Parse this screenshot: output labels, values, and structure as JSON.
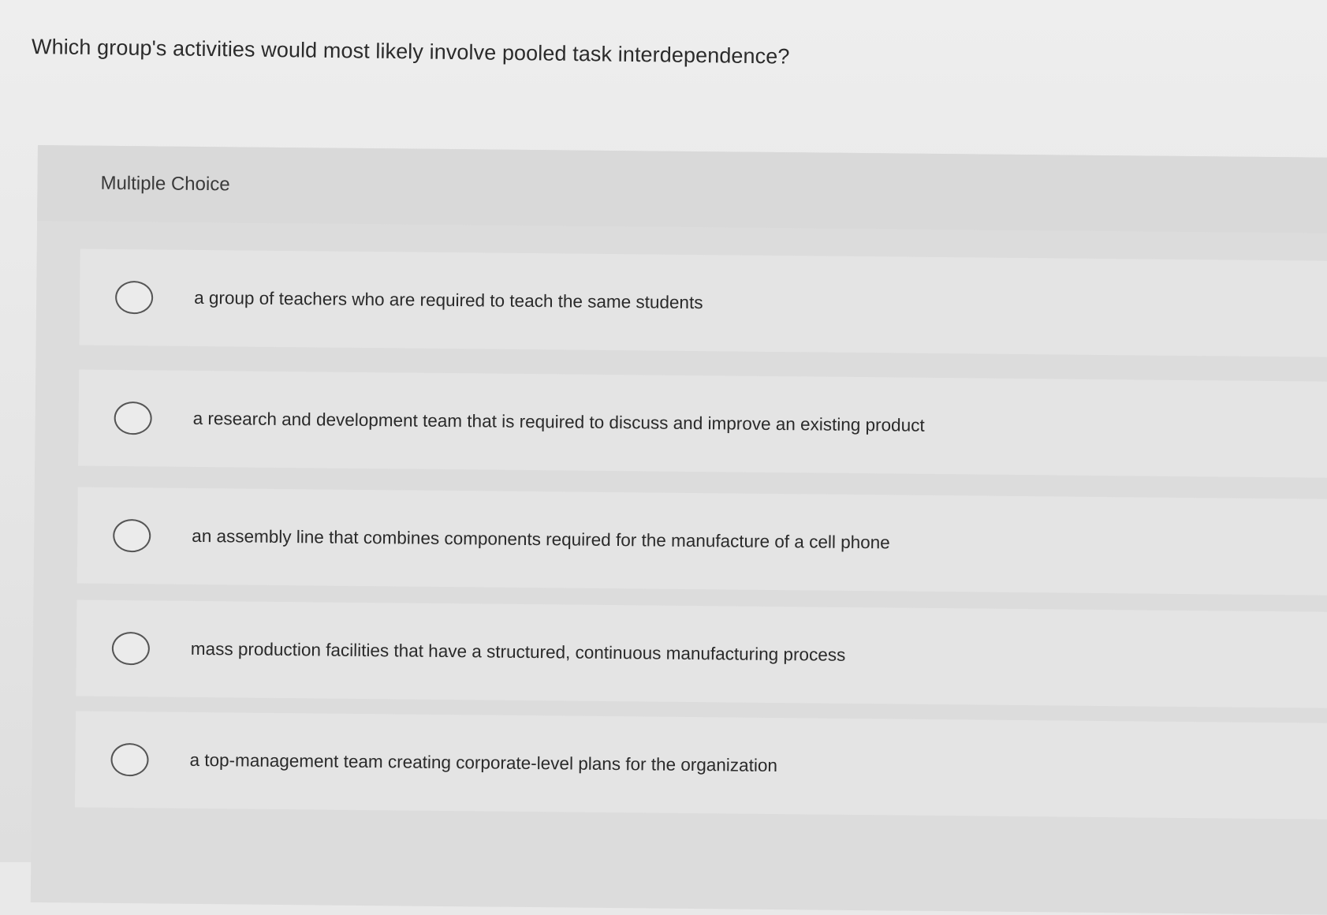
{
  "question": {
    "text": "Which group's activities would most likely involve pooled task interdependence?"
  },
  "multiple_choice": {
    "title": "Multiple Choice",
    "options": [
      {
        "label": "a group of teachers who are required to teach the same students"
      },
      {
        "label": "a research and development team that is required to discuss and improve an existing product"
      },
      {
        "label": "an assembly line that combines components required for the manufacture of a cell phone"
      },
      {
        "label": "mass production facilities that have a structured, continuous manufacturing process"
      },
      {
        "label": "a top-management team creating corporate-level plans for the organization"
      }
    ]
  },
  "colors": {
    "background": "#e9e9e9",
    "panel": "#dcdcdc",
    "option_row": "#e4e4e4",
    "text": "#2a2a2a",
    "radio_border": "#555555"
  },
  "icons": {
    "radio": "radio-empty-icon"
  }
}
